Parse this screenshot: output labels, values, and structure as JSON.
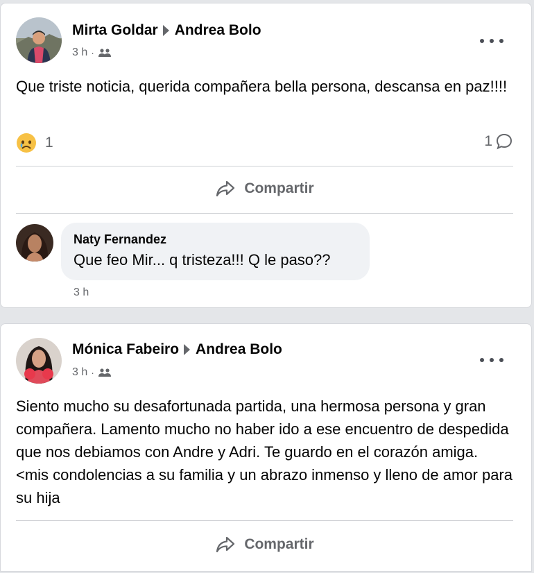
{
  "posts": [
    {
      "author": "Mirta Goldar",
      "target": "Andrea Bolo",
      "time": "3 h",
      "audience_icon": "friends-icon",
      "text": "Que triste noticia, querida compañera bella persona, descansa en paz!!!!",
      "reaction_icon": "sad-reaction-icon",
      "reaction_count": "1",
      "comment_count": "1",
      "share_label": "Compartir",
      "comment": {
        "author": "Naty Fernandez",
        "text": "Que feo Mir... q tristeza!!! Q le paso??",
        "time": "3 h"
      }
    },
    {
      "author": "Mónica Fabeiro",
      "target": "Andrea Bolo",
      "time": "3 h",
      "audience_icon": "friends-icon",
      "text": "Siento mucho su  desafortunada partida, una hermosa persona y gran compañera. Lamento mucho no haber ido a ese encuentro de despedida que nos debiamos con Andre y Adri. Te guardo en el corazón amiga. <mis condolencias a su familia y un abrazo inmenso y lleno de amor para su hija",
      "share_label": "Compartir"
    }
  ],
  "colors": {
    "background": "#e4e6e9",
    "card": "#ffffff",
    "secondary_text": "#65676b",
    "bubble": "#f0f2f5"
  }
}
